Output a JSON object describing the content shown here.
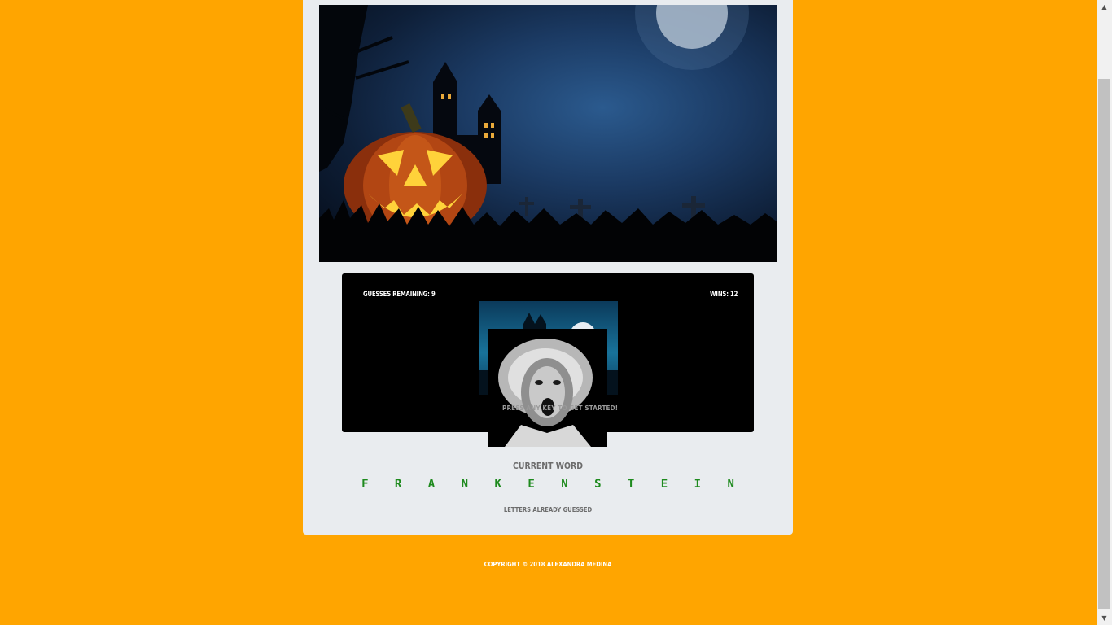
{
  "game": {
    "guesses_label": "GUESSES REMAINING: 9",
    "wins_label": "WINS: 12",
    "press_key_text": "PRESS ANY KEY TO GET STARTED!",
    "current_word_label": "CURRENT WORD",
    "current_word": "F R A N K E N S T E I N",
    "letters_guessed_label": "LETTERS ALREADY GUESSED"
  },
  "footer": {
    "copyright": "COPYRIGHT © 2018 ALEXANDRA MEDINA"
  },
  "icons": {
    "scroll_up": "triangle-up-icon",
    "scroll_down": "triangle-down-icon"
  },
  "colors": {
    "page_background": "#ffa500",
    "card_background": "#e9ecef",
    "panel_background": "#000000",
    "word_color": "#1e8a1e"
  }
}
